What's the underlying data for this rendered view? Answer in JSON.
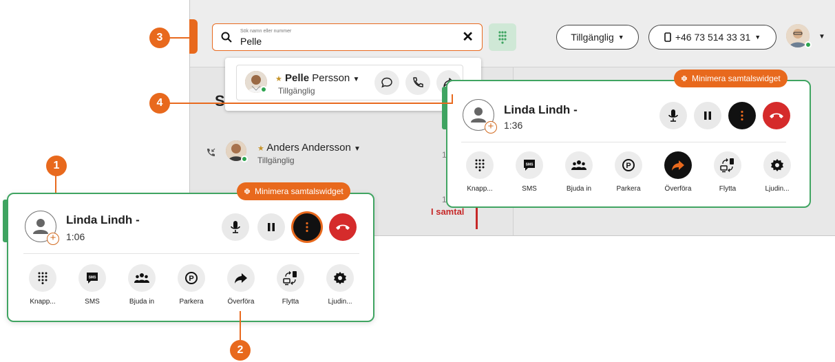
{
  "search": {
    "placeholder": "Sök namn eller nummer",
    "value": "Pelle"
  },
  "header": {
    "status_label": "Tillgänglig",
    "phone_number": "+46 73 514 33 31"
  },
  "list": {
    "section_letter": "S",
    "contact": {
      "name": "Anders Andersson",
      "status": "Tillgänglig",
      "num1": "1",
      "num2": "1"
    },
    "in_call_label": "I samtal"
  },
  "search_result": {
    "first_name": "Pelle",
    "last_name": "Persson",
    "status": "Tillgänglig"
  },
  "widget": {
    "minimize_label": "Minimera samtalswidget",
    "actions": [
      "Knapp...",
      "SMS",
      "Bjuda in",
      "Parkera",
      "Överföra",
      "Flytta",
      "Ljudin..."
    ]
  },
  "widget_top": {
    "caller_name": "Linda Lindh",
    "caller_suffix": "-",
    "duration": "1:36"
  },
  "widget_main": {
    "caller_name": "Linda Lindh",
    "caller_suffix": "-",
    "duration": "1:06"
  },
  "annotations": {
    "one": "1",
    "two": "2",
    "three": "3",
    "four": "4"
  },
  "colors": {
    "accent": "#e8691d",
    "success": "#3fa461",
    "danger": "#d52b2b"
  }
}
